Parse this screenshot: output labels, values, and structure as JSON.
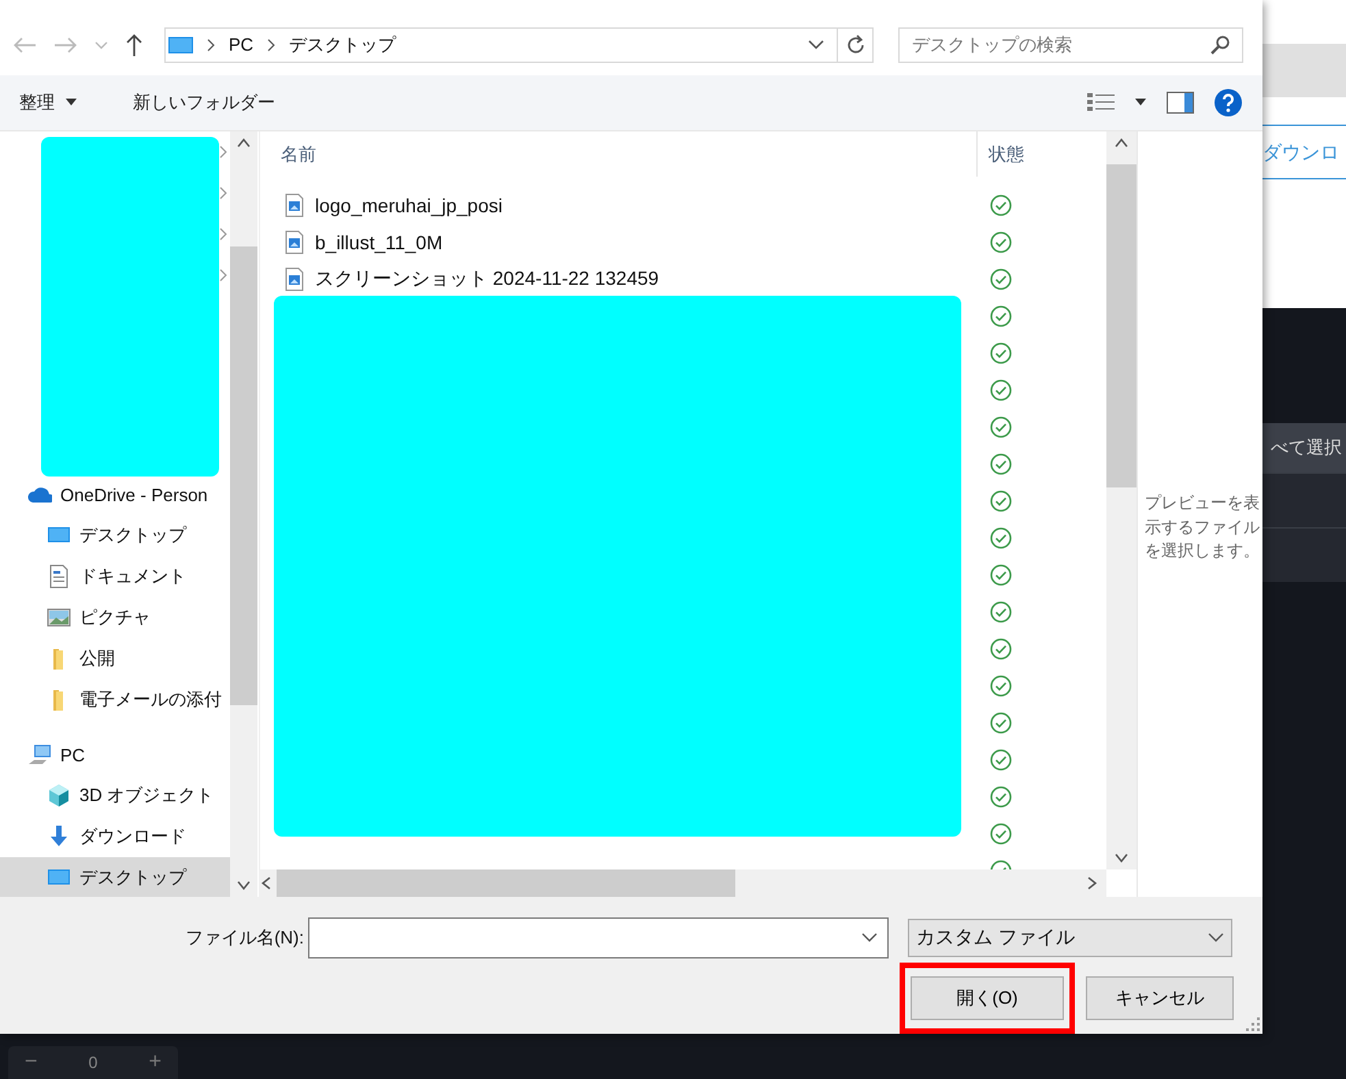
{
  "dialog": {
    "nav": {
      "path": [
        "PC",
        "デスクトップ"
      ],
      "search_placeholder": "デスクトップの検索"
    },
    "toolbar": {
      "organize": "整理",
      "new_folder": "新しいフォルダー"
    },
    "sidebar": {
      "items": [
        {
          "label": "OneDrive - Person",
          "kind": "cloud",
          "selected": false,
          "children": [
            {
              "label": "デスクトップ",
              "kind": "desktop",
              "selected": false
            },
            {
              "label": "ドキュメント",
              "kind": "document",
              "selected": false
            },
            {
              "label": "ピクチャ",
              "kind": "picture",
              "selected": false
            },
            {
              "label": "公開",
              "kind": "folder",
              "selected": false
            },
            {
              "label": "電子メールの添付",
              "kind": "folder",
              "selected": false
            }
          ]
        },
        {
          "label": "PC",
          "kind": "pc",
          "selected": false,
          "children": [
            {
              "label": "3D オブジェクト",
              "kind": "cube",
              "selected": false
            },
            {
              "label": "ダウンロード",
              "kind": "download",
              "selected": false
            },
            {
              "label": "デスクトップ",
              "kind": "desktop",
              "selected": true
            }
          ]
        }
      ]
    },
    "file_list": {
      "columns": [
        "名前",
        "状態"
      ],
      "rows": [
        {
          "kind": "file",
          "name": "logo_meruhai_jp_posi"
        },
        {
          "kind": "file",
          "name": "b_illust_11_0M"
        },
        {
          "kind": "file",
          "name": "スクリーンショット 2024-11-22 132459"
        },
        {
          "kind": "covered"
        },
        {
          "kind": "covered"
        },
        {
          "kind": "covered"
        },
        {
          "kind": "covered"
        },
        {
          "kind": "covered"
        },
        {
          "kind": "covered"
        },
        {
          "kind": "covered"
        },
        {
          "kind": "covered"
        },
        {
          "kind": "covered"
        },
        {
          "kind": "covered"
        },
        {
          "kind": "covered"
        },
        {
          "kind": "covered"
        },
        {
          "kind": "covered"
        },
        {
          "kind": "covered"
        },
        {
          "kind": "covered"
        },
        {
          "kind": "covered"
        }
      ]
    },
    "preview": {
      "message": "プレビューを表示するファイルを選択します。"
    },
    "footer": {
      "filename_label": "ファイル名(N):",
      "file_type": "カスタム ファイル",
      "buttons": [
        {
          "label": "開く(O)",
          "highlighted": true
        },
        {
          "label": "キャンセル",
          "highlighted": false
        }
      ]
    }
  },
  "background_app": {
    "link": "ダウンロ",
    "select_all": "べて選択",
    "counter": {
      "minus": "−",
      "value": "0",
      "plus": "+"
    }
  }
}
